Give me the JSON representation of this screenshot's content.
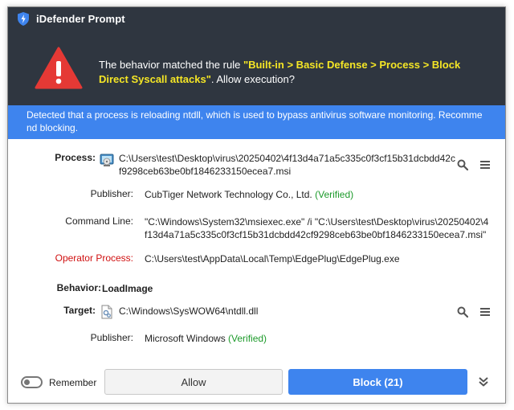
{
  "window": {
    "title": "iDefender Prompt"
  },
  "header": {
    "message_prefix": "The behavior matched the rule ",
    "rule": "\"Built-in > Basic Defense > Process > Block Direct Syscall attacks\"",
    "message_suffix": ". Allow execution?"
  },
  "banner": {
    "text": "Detected that a process is reloading ntdll, which is used to bypass antivirus software monitoring. Recommend blocking."
  },
  "details": {
    "process": {
      "label": "Process:",
      "path": "C:\\Users\\test\\Desktop\\virus\\20250402\\4f13d4a71a5c335c0f3cf15b31dcbdd42cf9298ceb63be0bf1846233150ecea7.msi"
    },
    "publisher": {
      "label": "Publisher:",
      "name": "CubTiger Network Technology Co., Ltd.",
      "status": "(Verified)"
    },
    "command_line": {
      "label": "Command Line:",
      "value": "\"C:\\Windows\\System32\\msiexec.exe\" /i \"C:\\Users\\test\\Desktop\\virus\\20250402\\4f13d4a71a5c335c0f3cf15b31dcbdd42cf9298ceb63be0bf1846233150ecea7.msi\""
    },
    "operator_process": {
      "label": "Operator Process:",
      "value": "C:\\Users\\test\\AppData\\Local\\Temp\\EdgePlug\\EdgePlug.exe"
    },
    "behavior": {
      "label": "Behavior:",
      "value": "LoadImage"
    },
    "target": {
      "label": "Target:",
      "path": "C:\\Windows\\SysWOW64\\ntdll.dll"
    },
    "target_publisher": {
      "label": "Publisher:",
      "name": "Microsoft Windows",
      "status": "(Verified)"
    }
  },
  "footer": {
    "remember_label": "Remember",
    "remember_on": false,
    "allow_label": "Allow",
    "block_label": "Block (21)"
  },
  "colors": {
    "header_bg": "#2f3640",
    "banner_bg": "#3e84ee",
    "rule_text": "#f5e625",
    "verified": "#1c9a2a",
    "operator_label": "#d01010",
    "block_button": "#3e84ee"
  },
  "icons": {
    "app": "shield-icon",
    "warning": "warning-triangle-icon",
    "process_file": "msi-installer-icon",
    "target_file": "dll-file-icon",
    "search": "search-icon",
    "menu": "menu-icon",
    "expand": "chevron-double-down-icon"
  }
}
